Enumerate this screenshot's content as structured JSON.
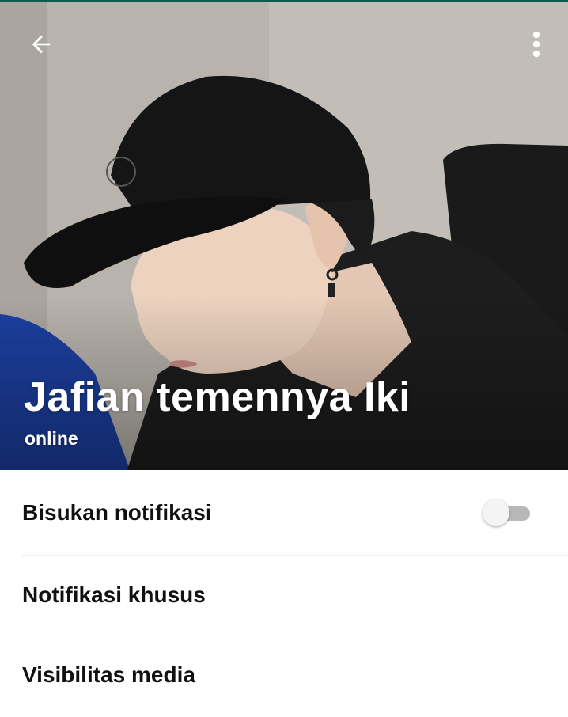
{
  "header": {
    "contact_name": "Jafian temennya Iki",
    "status": "online",
    "back_icon": "arrow-back-icon",
    "menu_icon": "more-vert-icon"
  },
  "settings": {
    "items": [
      {
        "label": "Bisukan notifikasi",
        "control": "toggle",
        "toggle_on": false
      },
      {
        "label": "Notifikasi khusus"
      },
      {
        "label": "Visibilitas media"
      }
    ]
  },
  "colors": {
    "accent_bar": "#0b5c4d",
    "toggle_track_off": "#b8b8b8",
    "toggle_thumb_off": "#f4f4f4",
    "text_primary": "#111111"
  }
}
